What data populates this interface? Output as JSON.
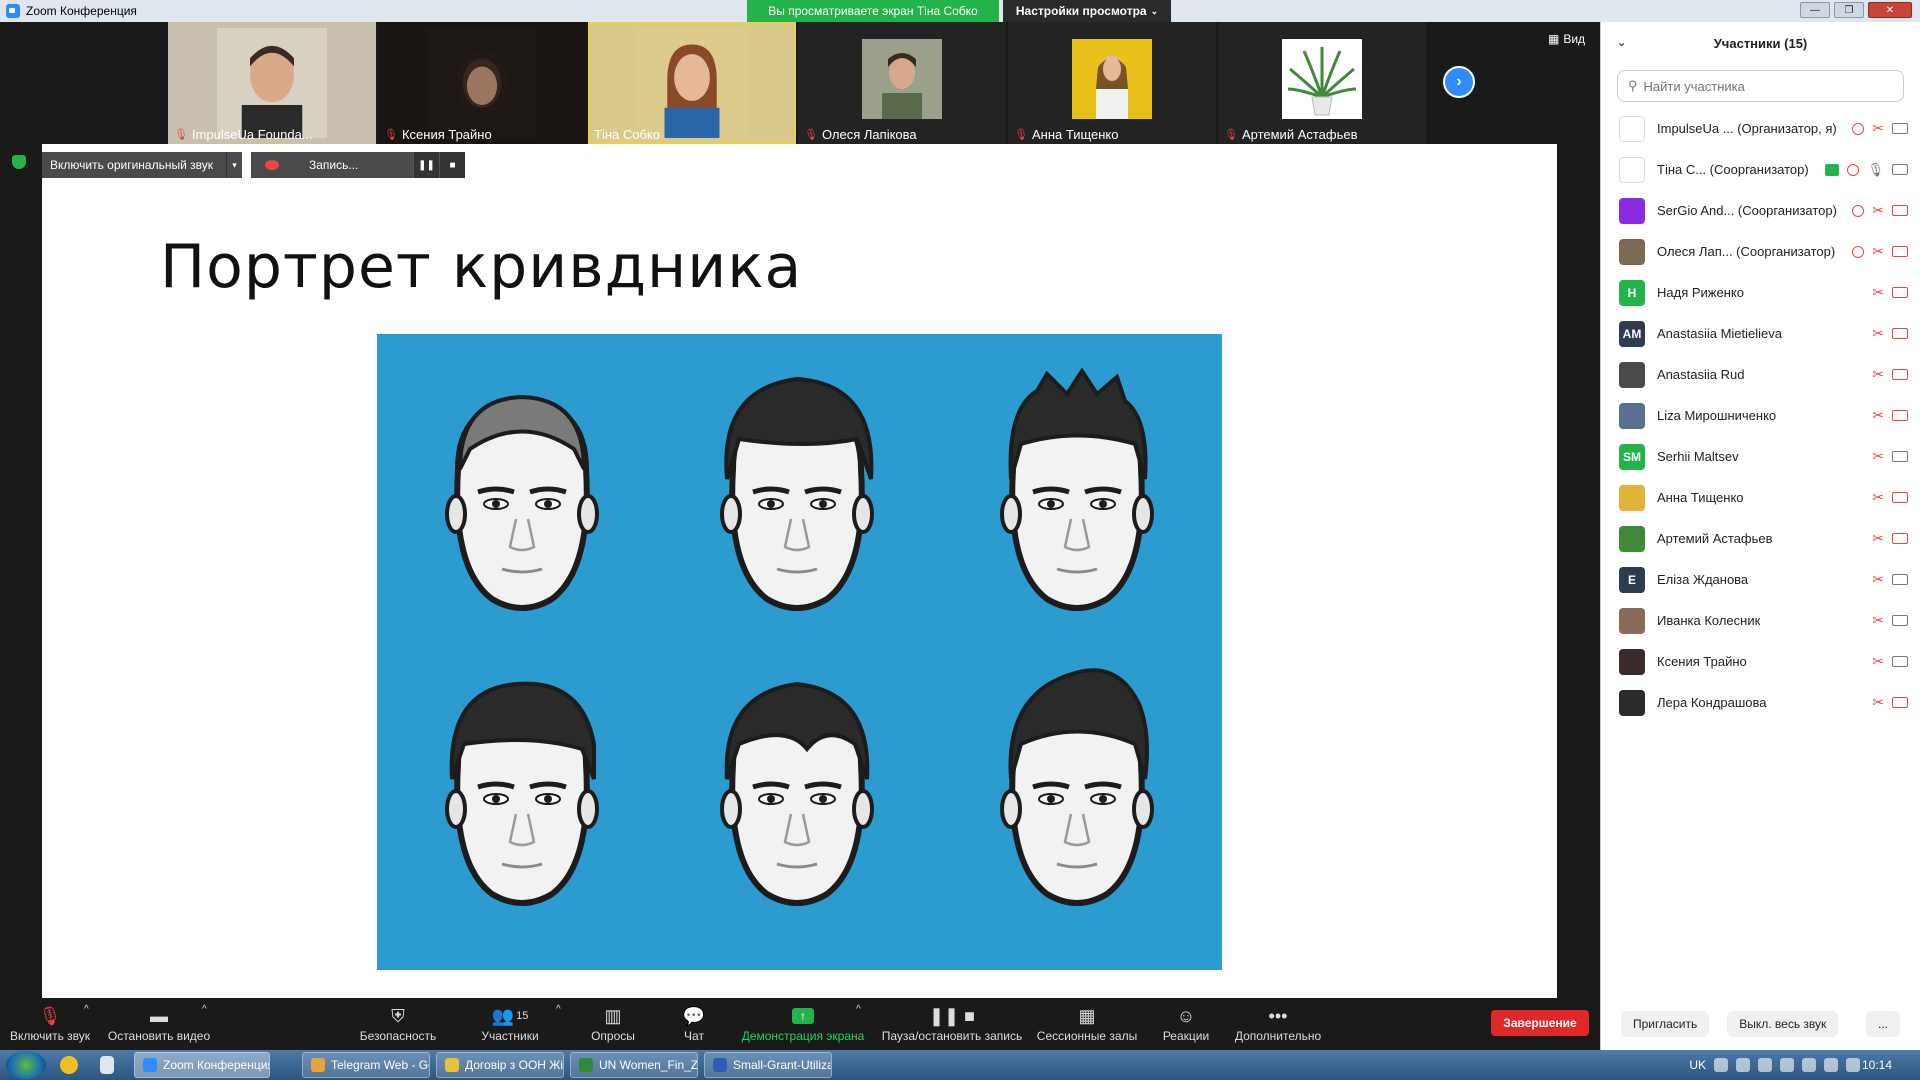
{
  "window": {
    "title": "Zoom Конференция",
    "banner_viewing": "Вы просматриваете экран Тіна Собко",
    "banner_view_settings": "Настройки просмотра",
    "minimize": "—",
    "restore": "❐",
    "close": "✕"
  },
  "thumbnails": [
    {
      "name": "ImpulseUa Founda...",
      "muted": true
    },
    {
      "name": "Ксения Трайно",
      "muted": true
    },
    {
      "name": "Тіна Собко",
      "muted": false
    },
    {
      "name": "Олеся Лапікова",
      "muted": true
    },
    {
      "name": "Анна Тищенко",
      "muted": true
    },
    {
      "name": "Артемий Астафьев",
      "muted": true
    }
  ],
  "view_button": "Вид",
  "controls": {
    "original_sound": "Включить оригинальный звук",
    "recording": "Запись..."
  },
  "slide": {
    "title": "Портрет кривдника"
  },
  "toolbar": {
    "unmute": "Включить звук",
    "stop_video": "Остановить видео",
    "security": "Безопасность",
    "participants": "Участники",
    "participants_count": "15",
    "polls": "Опросы",
    "chat": "Чат",
    "share_screen": "Демонстрация экрана",
    "pause_record": "Пауза/остановить запись",
    "breakout": "Сессионные залы",
    "reactions": "Реакции",
    "more": "Дополнительно",
    "end": "Завершение"
  },
  "panel": {
    "title": "Участники (15)",
    "search_placeholder": "Найти участника",
    "invite": "Пригласить",
    "mute_all": "Выкл. весь звук",
    "more": "...",
    "participants": [
      {
        "name": "ImpulseUa ... (Организатор, я)",
        "avatar": "",
        "color": "#ffffff",
        "cam": "on",
        "rec": true
      },
      {
        "name": "Тіна С... (Соорганизатор)",
        "avatar": "",
        "color": "#ffffff",
        "cam": "on",
        "share": true,
        "rec": true,
        "mic_on": true
      },
      {
        "name": "SerGio And... (Соорганизатор)",
        "avatar": "",
        "color": "#8a2be2",
        "cam": "off",
        "rec": true
      },
      {
        "name": "Олеся Лап... (Соорганизатор)",
        "avatar": "",
        "color": "#7a6a55",
        "cam": "off",
        "rec": true
      },
      {
        "name": "Надя Риженко",
        "avatar": "H",
        "color": "#24b24b",
        "cam": "off"
      },
      {
        "name": "Anastasiia Mietielieva",
        "avatar": "AM",
        "color": "#2f3c4f",
        "cam": "off"
      },
      {
        "name": "Anastasiia Rud",
        "avatar": "",
        "color": "#4a4a4a",
        "cam": "off"
      },
      {
        "name": "Liza Мирошниченко",
        "avatar": "",
        "color": "#5a7090",
        "cam": "off"
      },
      {
        "name": "Serhii Maltsev",
        "avatar": "SM",
        "color": "#24b24b",
        "cam": "on"
      },
      {
        "name": "Анна Тищенко",
        "avatar": "",
        "color": "#e2b43a",
        "cam": "off"
      },
      {
        "name": "Артемий Астафьев",
        "avatar": "",
        "color": "#3e8a3a",
        "cam": "off"
      },
      {
        "name": "Еліза Жданова",
        "avatar": "E",
        "color": "#2f3c4f",
        "cam": "on"
      },
      {
        "name": "Иванка Колесник",
        "avatar": "",
        "color": "#8a6a5a",
        "cam": "on"
      },
      {
        "name": "Ксения Трайно",
        "avatar": "",
        "color": "#3a2a2a",
        "cam": "on"
      },
      {
        "name": "Лера Кондрашова",
        "avatar": "",
        "color": "#2a2a2a",
        "cam": "off"
      }
    ]
  },
  "taskbar": {
    "tasks": [
      {
        "label": "Zoom Конференция",
        "active": true,
        "color": "#2d8cff"
      },
      {
        "label": "Telegram Web - Goo...",
        "active": false,
        "color": "#e8a33a"
      },
      {
        "label": "Договір з ООН Жінки",
        "active": false,
        "color": "#e8c33a"
      },
      {
        "label": "UN Women_Fin_Zvit...",
        "active": false,
        "color": "#2e8b3a"
      },
      {
        "label": "Small-Grant-Utilizati...",
        "active": false,
        "color": "#2b5fb3"
      }
    ],
    "lang": "UK",
    "time": "10:14"
  }
}
